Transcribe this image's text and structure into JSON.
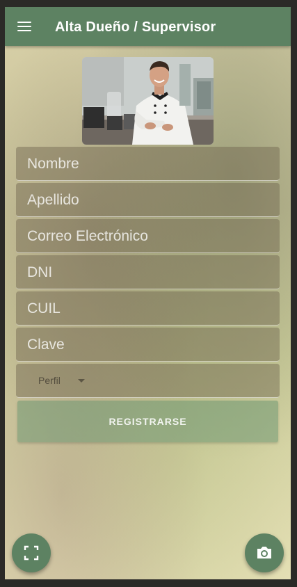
{
  "appbar": {
    "title": "Alta Dueño / Supervisor",
    "menu_icon": "menu-icon"
  },
  "photo": {
    "description_icon": "chef-photo"
  },
  "form": {
    "nombre_placeholder": "Nombre",
    "apellido_placeholder": "Apellido",
    "correo_placeholder": "Correo Electrónico",
    "dni_placeholder": "DNI",
    "cuil_placeholder": "CUIL",
    "clave_placeholder": "Clave",
    "perfil_selected": "Perfil",
    "register_label": "REGISTRARSE"
  },
  "fabs": {
    "left_icon": "fullscreen-icon",
    "right_icon": "camera-icon"
  },
  "colors": {
    "primary": "#5d8262",
    "button": "#709873"
  }
}
